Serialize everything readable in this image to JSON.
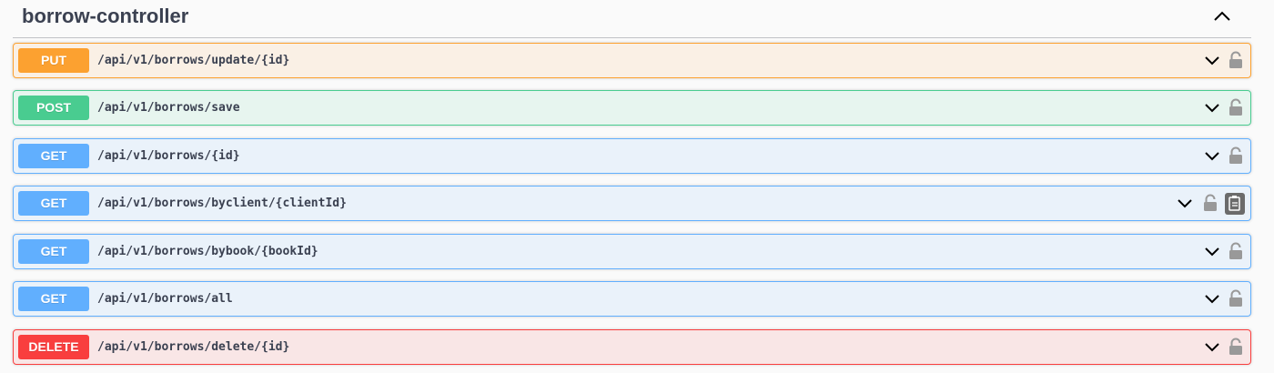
{
  "tag": {
    "title": "borrow-controller",
    "toggle_icon": "chevron-up-icon"
  },
  "operations": [
    {
      "method": "PUT",
      "path": "/api/v1/borrows/update/{id}"
    },
    {
      "method": "POST",
      "path": "/api/v1/borrows/save"
    },
    {
      "method": "GET",
      "path": "/api/v1/borrows/{id}"
    },
    {
      "method": "GET",
      "path": "/api/v1/borrows/byclient/{clientId}"
    },
    {
      "method": "GET",
      "path": "/api/v1/borrows/bybook/{bookId}"
    },
    {
      "method": "GET",
      "path": "/api/v1/borrows/all"
    },
    {
      "method": "DELETE",
      "path": "/api/v1/borrows/delete/{id}"
    }
  ],
  "icons": {
    "expand": "chevron-down-icon",
    "lock": "lock-icon",
    "copy": "copy-to-clipboard-icon"
  },
  "colors": {
    "put": "#fca130",
    "post": "#49cc90",
    "get": "#61affe",
    "delete": "#f93e3e",
    "text": "#3b4151"
  }
}
